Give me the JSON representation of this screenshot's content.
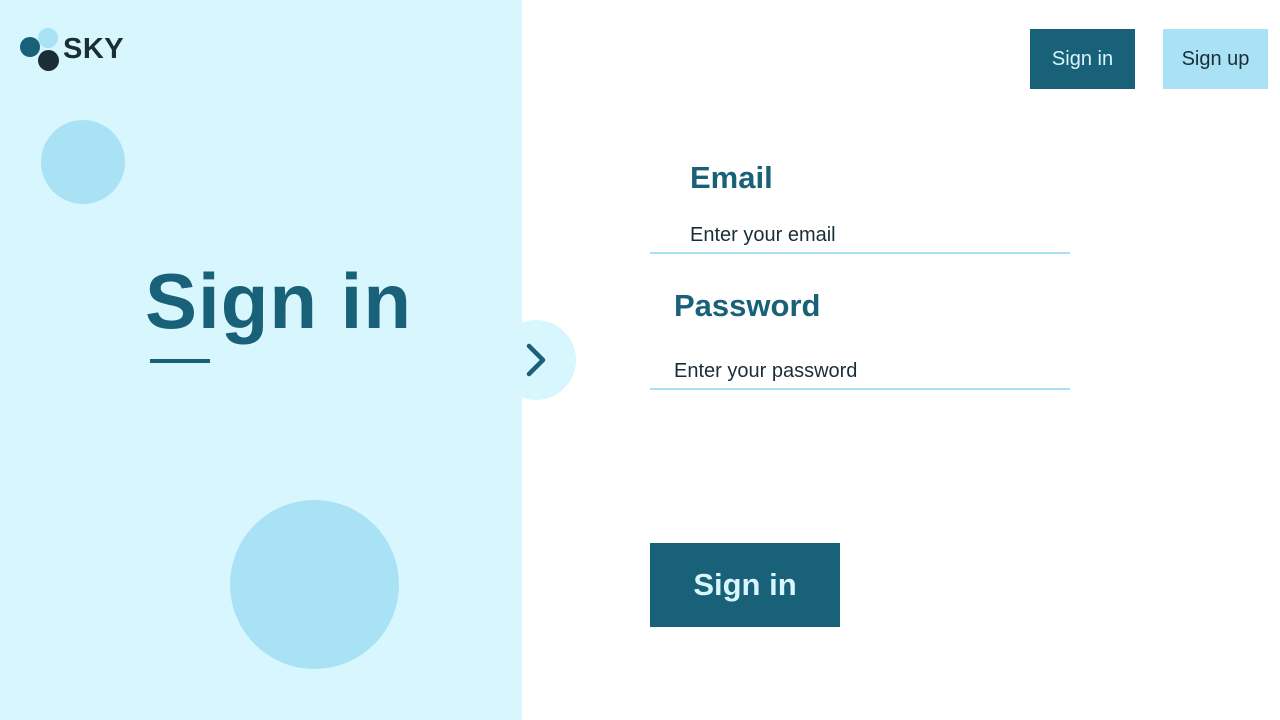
{
  "logo": {
    "text": "SKY",
    "dot_colors": [
      "#186178",
      "#a9e2f4",
      "#1b2d36"
    ]
  },
  "header": {
    "signin_label": "Sign in",
    "signup_label": "Sign up"
  },
  "hero": {
    "title": "Sign in",
    "arrow_icon": "chevron-right-icon"
  },
  "form": {
    "email_label": "Email",
    "email_placeholder": "Enter your email",
    "password_label": "Password",
    "password_placeholder": "Enter your password",
    "submit_label": "Sign in"
  },
  "colors": {
    "panel_bg": "#d8f6fe",
    "accent": "#186178",
    "light_accent": "#a9e2f4",
    "dark": "#1b2d36"
  }
}
